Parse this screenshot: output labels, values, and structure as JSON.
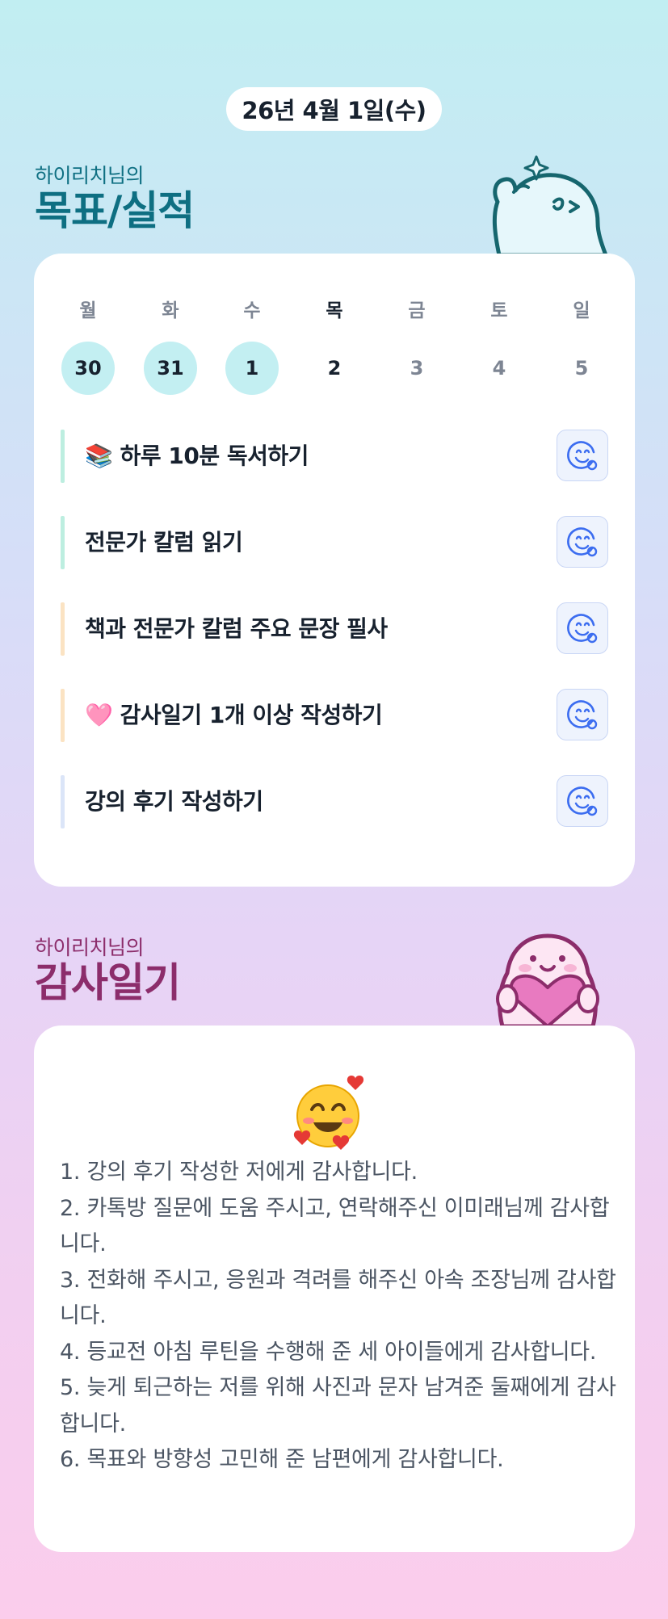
{
  "date_label": "26년 4월 1일(수)",
  "goals_section": {
    "subtitle": "하이리치님의",
    "title": "목표/실적"
  },
  "week": {
    "days": [
      {
        "name": "월",
        "date": "30",
        "state": "done"
      },
      {
        "name": "화",
        "date": "31",
        "state": "done"
      },
      {
        "name": "수",
        "date": "1",
        "state": "done"
      },
      {
        "name": "목",
        "date": "2",
        "state": "today"
      },
      {
        "name": "금",
        "date": "3",
        "state": "future"
      },
      {
        "name": "토",
        "date": "4",
        "state": "future"
      },
      {
        "name": "일",
        "date": "5",
        "state": "future"
      }
    ],
    "done_color": "#c3eff2"
  },
  "goals": [
    {
      "label": "📚 하루 10분 독서하기",
      "bar_color": "#bdeee0",
      "icon": "smile-check-icon"
    },
    {
      "label": "전문가 칼럼 읽기",
      "bar_color": "#bdeee0",
      "icon": "smile-check-icon"
    },
    {
      "label": "책과 전문가 칼럼 주요 문장 필사",
      "bar_color": "#fbe3c3",
      "icon": "smile-check-icon"
    },
    {
      "label": "🩷 감사일기 1개 이상 작성하기",
      "bar_color": "#fbe3c3",
      "icon": "smile-check-icon"
    },
    {
      "label": "강의 후기 작성하기",
      "bar_color": "#dbe5f8",
      "icon": "smile-check-icon"
    }
  ],
  "thanks_section": {
    "subtitle": "하이리치님의",
    "title": "감사일기",
    "emoji": "smiling-face-with-hearts",
    "entries_text": "1. 강의 후기 작성한 저에게 감사합니다.\n2. 카톡방 질문에 도움 주시고, 연락해주신 이미래님께 감사합니다.\n3. 전화해 주시고, 응원과 격려를 해주신 아속 조장님께 감사합니다.\n4. 등교전 아침 루틴을 수행해 준 세 아이들에게 감사합니다.\n5. 늦게 퇴근하는 저를 위해 사진과 문자 남겨준 둘째에게 감사합니다.\n6. 목표와 방향성 고민해 준 남편에게 감사합니다."
  },
  "colors": {
    "goal_title": "#0e6f82",
    "thanks_title": "#8c2d6b",
    "icon_blue": "#3c6df0"
  }
}
